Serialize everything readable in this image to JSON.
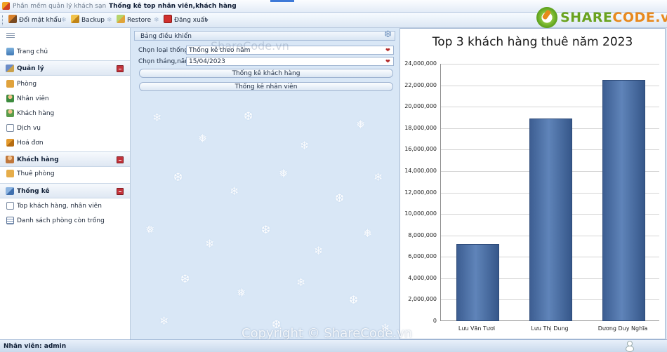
{
  "window": {
    "app_title": "Phần mềm quản lý khách sạn",
    "form_title": "Thống kê top nhân viên,khách hàng"
  },
  "toolbar": {
    "change_password": "Đổi mật khẩu",
    "backup": "Backup",
    "restore": "Restore",
    "logout": "Đăng xuất",
    "separator": "❄"
  },
  "logo": {
    "part1": "SHARE",
    "part2": "CODE.vn"
  },
  "sidebar": {
    "home": "Trang chủ",
    "groups": [
      {
        "label": "Quản lý",
        "items": [
          "Phòng",
          "Nhân viên",
          "Khách hàng",
          "Dịch vụ",
          "Hoá đơn"
        ]
      },
      {
        "label": "Khách hàng",
        "items": [
          "Thuê phòng"
        ]
      },
      {
        "label": "Thống kê",
        "items": [
          "Top khách hàng, nhân viên",
          "Danh sách phòng còn trống"
        ]
      }
    ]
  },
  "control_panel": {
    "header": "Bảng điều khiển",
    "type_label": "Chọn loại thống kê",
    "type_value": "Thống kê theo năm",
    "date_label": "Chọn tháng,năm",
    "date_value": "15/04/2023",
    "btn_customer": "Thống kê khách hàng",
    "btn_employee": "Thống kê nhân viên"
  },
  "watermark": "ShareCode.vn",
  "copyright": "Copyright © ShareCode.vn",
  "status": {
    "text": "Nhân viên: admin"
  },
  "chart_data": {
    "type": "bar",
    "title": "Top 3 khách hàng thuê năm 2023",
    "categories": [
      "Lưu Văn Tươi",
      "Lưu Thị Dung",
      "Dương Duy Nghĩa"
    ],
    "values": [
      7200000,
      18900000,
      22500000
    ],
    "ylim": [
      0,
      24000000
    ],
    "yticks": [
      "0",
      "2,000,000",
      "4,000,000",
      "6,000,000",
      "8,000,000",
      "10,000,000",
      "12,000,000",
      "14,000,000",
      "16,000,000",
      "18,000,000",
      "20,000,000",
      "22,000,000",
      "24,000,000"
    ],
    "grid": true,
    "bar_color": "#4a6ea5"
  }
}
